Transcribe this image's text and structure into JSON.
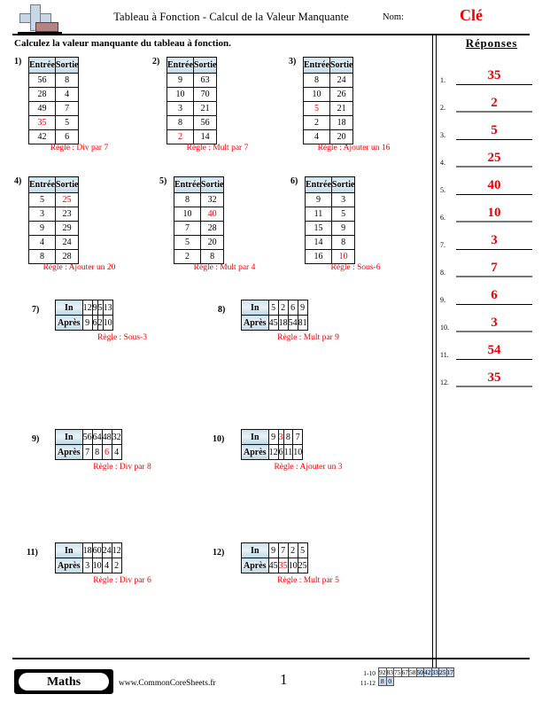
{
  "header": {
    "title": "Tableau à Fonction - Calcul de la Valeur Manquante",
    "name_label": "Nom:",
    "name_value": "Clé",
    "instruction": "Calculez la valeur manquante du tableau à fonction.",
    "logo_name": "math-plus-logo"
  },
  "answers": {
    "title": "Réponses",
    "items": [
      {
        "n": "1.",
        "value": "35"
      },
      {
        "n": "2.",
        "value": "2"
      },
      {
        "n": "3.",
        "value": "5"
      },
      {
        "n": "4.",
        "value": "25"
      },
      {
        "n": "5.",
        "value": "40"
      },
      {
        "n": "6.",
        "value": "10"
      },
      {
        "n": "7.",
        "value": "3"
      },
      {
        "n": "8.",
        "value": "7"
      },
      {
        "n": "9.",
        "value": "6"
      },
      {
        "n": "10.",
        "value": "3"
      },
      {
        "n": "11.",
        "value": "54"
      },
      {
        "n": "12.",
        "value": "35"
      }
    ]
  },
  "vertical_tables": [
    {
      "index": "1)",
      "headers": [
        "Entrée",
        "Sortie"
      ],
      "rows": [
        {
          "in": "56",
          "out": "8",
          "missing": null
        },
        {
          "in": "28",
          "out": "4",
          "missing": null
        },
        {
          "in": "49",
          "out": "7",
          "missing": null
        },
        {
          "in": "35",
          "out": "5",
          "missing": "in"
        },
        {
          "in": "42",
          "out": "6",
          "missing": null
        }
      ],
      "rule": "Règle : Div par 7"
    },
    {
      "index": "2)",
      "headers": [
        "Entrée",
        "Sortie"
      ],
      "rows": [
        {
          "in": "9",
          "out": "63",
          "missing": null
        },
        {
          "in": "10",
          "out": "70",
          "missing": null
        },
        {
          "in": "3",
          "out": "21",
          "missing": null
        },
        {
          "in": "8",
          "out": "56",
          "missing": null
        },
        {
          "in": "2",
          "out": "14",
          "missing": "in"
        }
      ],
      "rule": "Règle : Mult par 7"
    },
    {
      "index": "3)",
      "headers": [
        "Entrée",
        "Sortie"
      ],
      "rows": [
        {
          "in": "8",
          "out": "24",
          "missing": null
        },
        {
          "in": "10",
          "out": "26",
          "missing": null
        },
        {
          "in": "5",
          "out": "21",
          "missing": "in"
        },
        {
          "in": "2",
          "out": "18",
          "missing": null
        },
        {
          "in": "4",
          "out": "20",
          "missing": null
        }
      ],
      "rule": "Règle : Ajouter un 16"
    },
    {
      "index": "4)",
      "headers": [
        "Entrée",
        "Sortie"
      ],
      "rows": [
        {
          "in": "5",
          "out": "25",
          "missing": "out"
        },
        {
          "in": "3",
          "out": "23",
          "missing": null
        },
        {
          "in": "9",
          "out": "29",
          "missing": null
        },
        {
          "in": "4",
          "out": "24",
          "missing": null
        },
        {
          "in": "8",
          "out": "28",
          "missing": null
        }
      ],
      "rule": "Règle : Ajouter un 20"
    },
    {
      "index": "5)",
      "headers": [
        "Entrée",
        "Sortie"
      ],
      "rows": [
        {
          "in": "8",
          "out": "32",
          "missing": null
        },
        {
          "in": "10",
          "out": "40",
          "missing": "out"
        },
        {
          "in": "7",
          "out": "28",
          "missing": null
        },
        {
          "in": "5",
          "out": "20",
          "missing": null
        },
        {
          "in": "2",
          "out": "8",
          "missing": null
        }
      ],
      "rule": "Règle : Mult par 4"
    },
    {
      "index": "6)",
      "headers": [
        "Entrée",
        "Sortie"
      ],
      "rows": [
        {
          "in": "9",
          "out": "3",
          "missing": null
        },
        {
          "in": "11",
          "out": "5",
          "missing": null
        },
        {
          "in": "15",
          "out": "9",
          "missing": null
        },
        {
          "in": "14",
          "out": "8",
          "missing": null
        },
        {
          "in": "16",
          "out": "10",
          "missing": "out"
        }
      ],
      "rule": "Règle : Sous-6"
    }
  ],
  "horizontal_tables": [
    {
      "index": "7)",
      "row_labels": [
        "In",
        "Après"
      ],
      "in": [
        "12",
        "9",
        "5",
        "13"
      ],
      "out": [
        "9",
        "6",
        "2",
        "10"
      ],
      "missing_row": null,
      "missing_col": null,
      "rule": "Règle : Sous-3"
    },
    {
      "index": "8)",
      "row_labels": [
        "In",
        "Après"
      ],
      "in": [
        "5",
        "2",
        "6",
        "9"
      ],
      "out": [
        "45",
        "18",
        "54",
        "81"
      ],
      "missing_row": null,
      "missing_col": null,
      "rule": "Règle : Mult par 9"
    },
    {
      "index": "9)",
      "row_labels": [
        "In",
        "Après"
      ],
      "in": [
        "56",
        "64",
        "48",
        "32"
      ],
      "out": [
        "7",
        "8",
        "6",
        "4"
      ],
      "missing_row": "out",
      "missing_col": 2,
      "rule": "Règle : Div par 8"
    },
    {
      "index": "10)",
      "row_labels": [
        "In",
        "Après"
      ],
      "in": [
        "9",
        "3",
        "8",
        "7"
      ],
      "out": [
        "12",
        "6",
        "11",
        "10"
      ],
      "missing_row": "in",
      "missing_col": 1,
      "rule": "Règle : Ajouter un 3"
    },
    {
      "index": "11)",
      "row_labels": [
        "In",
        "Après"
      ],
      "in": [
        "18",
        "60",
        "24",
        "12"
      ],
      "out": [
        "3",
        "10",
        "4",
        "2"
      ],
      "missing_row": null,
      "missing_col": null,
      "rule": "Règle : Div par 6"
    },
    {
      "index": "12)",
      "row_labels": [
        "In",
        "Après"
      ],
      "in": [
        "9",
        "7",
        "2",
        "5"
      ],
      "out": [
        "45",
        "35",
        "10",
        "25"
      ],
      "missing_row": "out",
      "missing_col": 1,
      "rule": "Règle : Mult par 5"
    }
  ],
  "footer": {
    "badge": "Maths",
    "site": "www.CommonCoreSheets.fr",
    "page_number": "1",
    "score_rows": [
      {
        "label": "1-10",
        "cells": [
          {
            "v": "92",
            "hl": false
          },
          {
            "v": "83",
            "hl": false
          },
          {
            "v": "75",
            "hl": false
          },
          {
            "v": "67",
            "hl": false
          },
          {
            "v": "58",
            "hl": false
          },
          {
            "v": "50",
            "hl": true
          },
          {
            "v": "42",
            "hl": true
          },
          {
            "v": "33",
            "hl": true
          },
          {
            "v": "25",
            "hl": true
          },
          {
            "v": "17",
            "hl": true
          }
        ]
      },
      {
        "label": "11-12",
        "cells": [
          {
            "v": "8",
            "hl": true
          },
          {
            "v": "0",
            "hl": true
          }
        ]
      }
    ]
  },
  "colors": {
    "answer_red": "#ee0000",
    "header_blue": "#cfe3ee",
    "score_highlight": "#c8d8f0"
  }
}
